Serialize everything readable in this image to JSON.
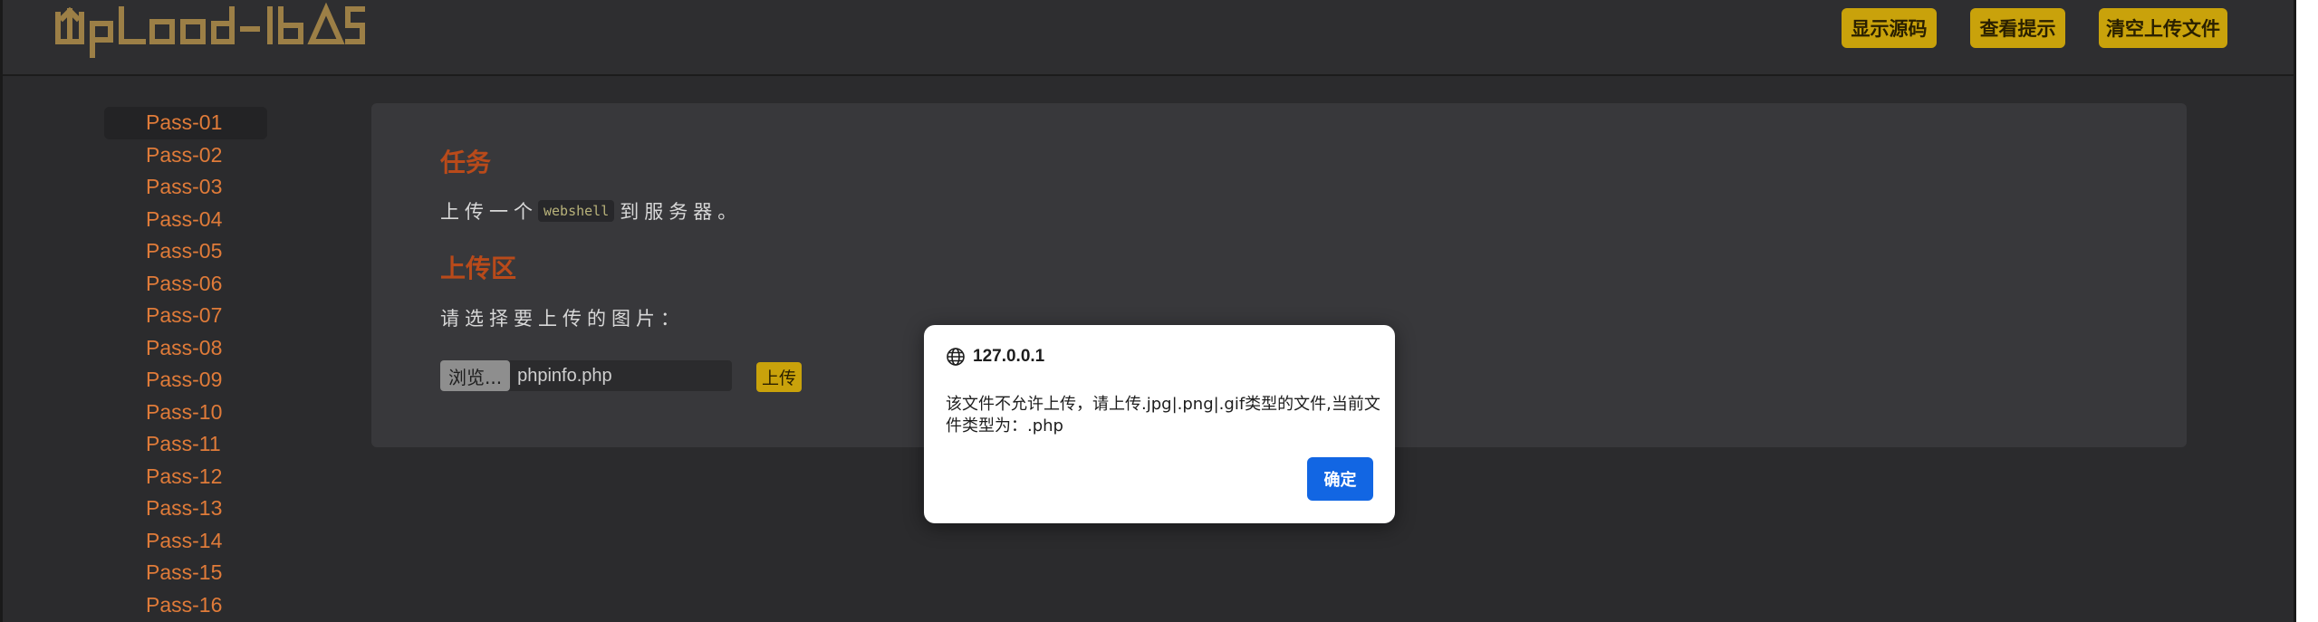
{
  "header": {
    "logo_text": "Upload-labS",
    "buttons": [
      "显示源码",
      "查看提示",
      "清空上传文件"
    ]
  },
  "sidebar": {
    "items": [
      "Pass-01",
      "Pass-02",
      "Pass-03",
      "Pass-04",
      "Pass-05",
      "Pass-06",
      "Pass-07",
      "Pass-08",
      "Pass-09",
      "Pass-10",
      "Pass-11",
      "Pass-12",
      "Pass-13",
      "Pass-14",
      "Pass-15",
      "Pass-16"
    ],
    "active": "Pass-01"
  },
  "main": {
    "task_title": "任务",
    "task_prefix": "上传一个",
    "task_code": "webshell",
    "task_suffix": "到服务器。",
    "upload_title": "上传区",
    "choose_label": "请选择要上传的图片：",
    "browse_label": "浏览...",
    "file_name": "phpinfo.php",
    "upload_button": "上传"
  },
  "dialog": {
    "origin": "127.0.0.1",
    "message": "该文件不允许上传，请上传.jpg|.png|.gif类型的文件,当前文件类型为：.php",
    "ok_label": "确定"
  },
  "colors": {
    "background": "#2b2b2d",
    "accent_gold": "#c9a20b",
    "link_orange": "#e07b39",
    "title_red": "#b94a1a",
    "ok_blue": "#1266e3"
  },
  "icons": [
    "upload-logo-icon",
    "globe-icon"
  ]
}
